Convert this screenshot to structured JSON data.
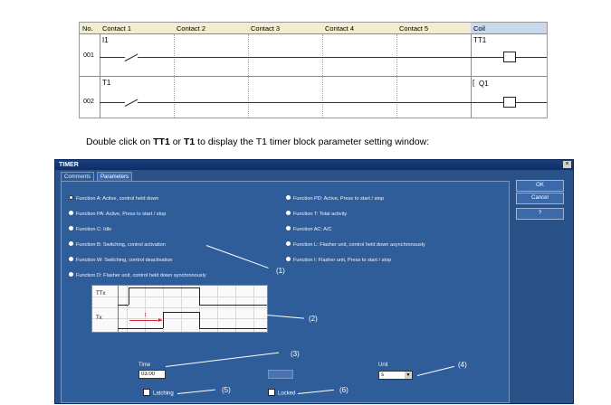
{
  "ladder": {
    "headers": [
      "No.",
      "Contact 1",
      "Contact 2",
      "Contact 3",
      "Contact 4",
      "Contact 5",
      "Coil"
    ],
    "rows": [
      {
        "no": "001",
        "contact": "I1",
        "coil": "TT1"
      },
      {
        "no": "002",
        "contact": "T1",
        "coil_prefix": "[",
        "coil": "Q1"
      }
    ]
  },
  "instruction": {
    "before": "Double click on ",
    "bold1": "TT1",
    "mid": " or ",
    "bold2": "T1",
    "after": " to display the T1 timer block parameter setting window:"
  },
  "dialog": {
    "title": "TIMER",
    "close": "×",
    "tabs": [
      "Comments",
      "Parameters"
    ],
    "buttons": {
      "ok": "OK",
      "cancel": "Cancel",
      "help": "?"
    },
    "functions_left": [
      "Function A: Active, control held down",
      "Function PA: Active, Press to start / stop",
      "Function C: Idle",
      "Function B: Switching, control activation",
      "Function W: Switching, control deactivation",
      "Function D: Flasher unit, control held down synchronously"
    ],
    "functions_right": [
      "Function PD: Active, Press to start / stop",
      "Function T: Total activity",
      "Function AC: A/C",
      "Function L: Flasher unit, control held down asynchronously",
      "Function I: Flasher unit, Press to start / stop"
    ],
    "selected_function_index": 0,
    "graph": {
      "label_top": "TTx",
      "label_bottom": "Tx",
      "t_label": "t"
    },
    "time_label": "Time",
    "time_value": "03.00",
    "unit_label": "Unit",
    "unit_value": "s",
    "latching_label": "Latching",
    "locked_label": "Locked",
    "annotations": [
      "(1)",
      "(2)",
      "(3)",
      "(4)",
      "(5)",
      "(6)"
    ]
  },
  "colors": {
    "dialog_bg": "#2f5d99",
    "title_bar": "#0e2d66",
    "coil_header": "#c9d9ea",
    "contact_header": "#f1edd2"
  }
}
